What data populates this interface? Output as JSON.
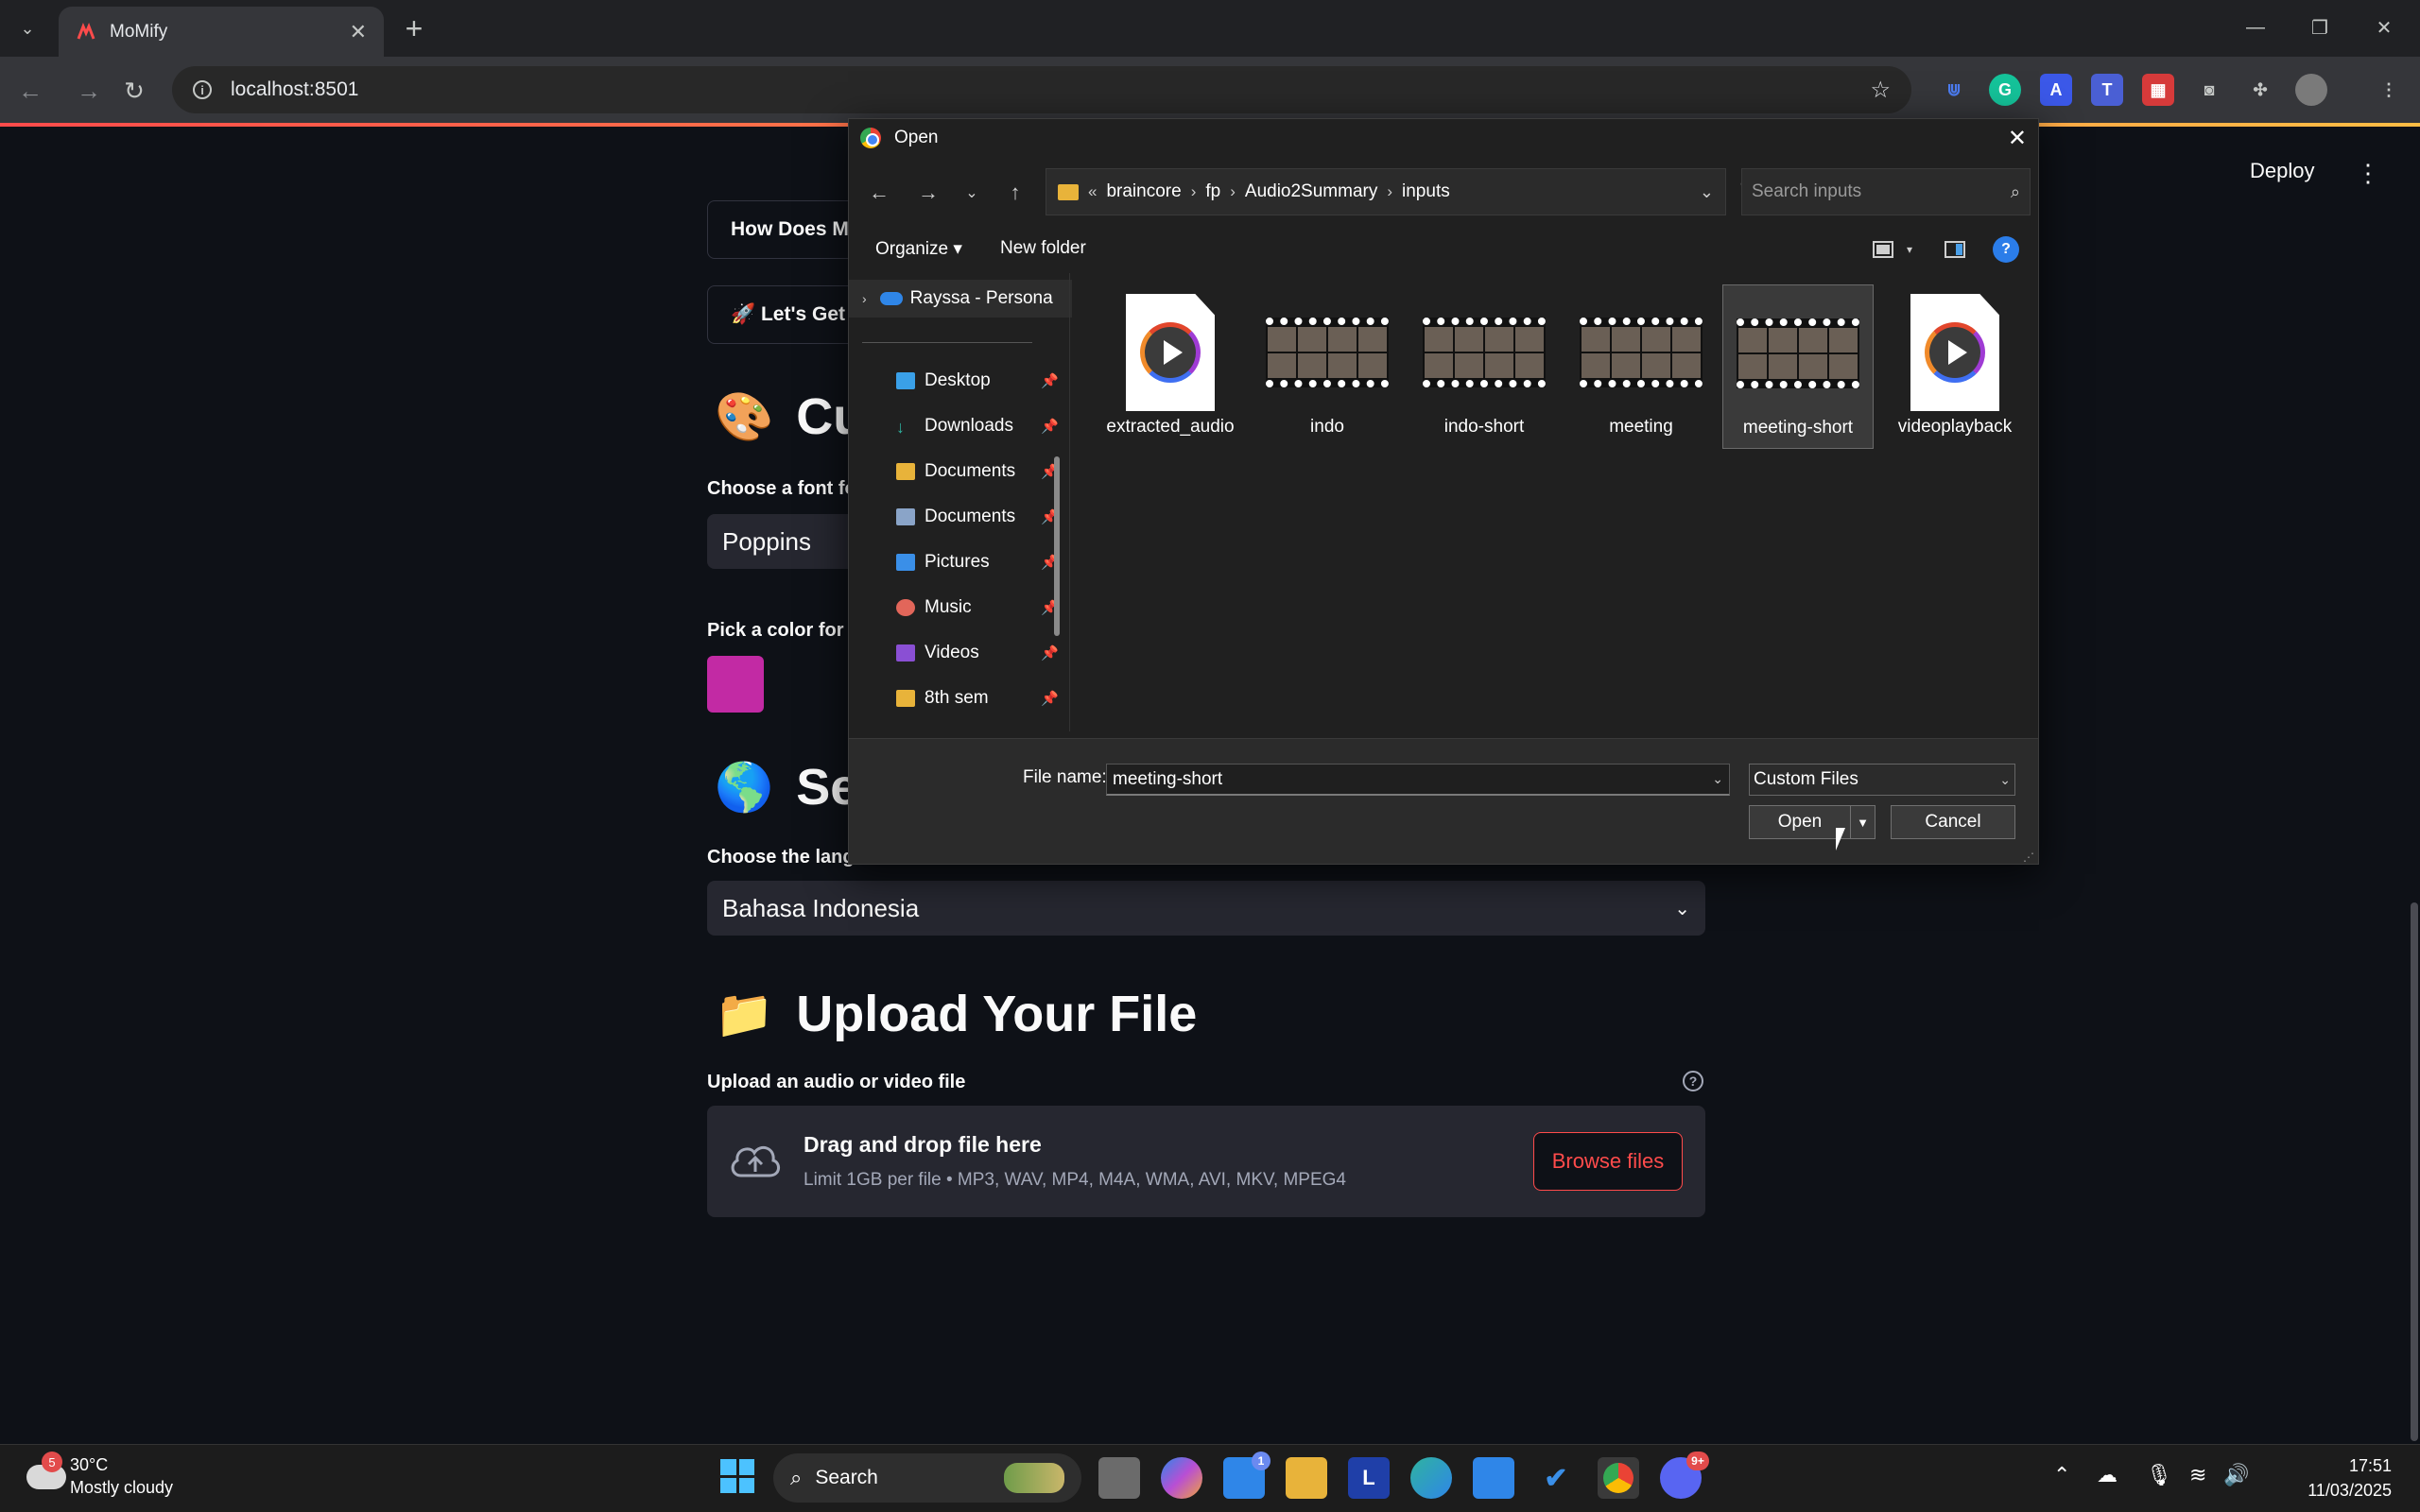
{
  "browser": {
    "tab_title": "MoMify",
    "url": "localhost:8501"
  },
  "app": {
    "deploy_label": "Deploy",
    "expander_how": "How Does MoM",
    "expander_start": "🚀 Let's Get",
    "custom_emoji": "🎨",
    "custom_title": "Cus",
    "font_label": "Choose a font fo",
    "font_value": "Poppins",
    "color_label": "Pick a color for bo",
    "color_value": "#c22aa4",
    "lang_emoji": "🌎",
    "lang_title": "Sel",
    "lang_label": "Choose the langu",
    "lang_value": "Bahasa Indonesia",
    "upload_emoji": "📁",
    "upload_title": "Upload Your File",
    "upload_label": "Upload an audio or video file",
    "drag_text": "Drag and drop file here",
    "limit_text": "Limit 1GB per file • MP3, WAV, MP4, M4A, WMA, AVI, MKV, MPEG4",
    "browse_label": "Browse files"
  },
  "dialog": {
    "title": "Open",
    "breadcrumb": [
      "braincore",
      "fp",
      "Audio2Summary",
      "inputs"
    ],
    "search_placeholder": "Search inputs",
    "organize_label": "Organize ▾",
    "new_folder_label": "New folder",
    "onedrive_label": "Rayssa - Persona",
    "nav_items": [
      {
        "label": "Desktop",
        "color": "#3aa0e8"
      },
      {
        "label": "Downloads",
        "color": "#2fb3a0"
      },
      {
        "label": "Documents",
        "color": "#e8b33a"
      },
      {
        "label": "Documents",
        "color": "#8aa4c8"
      },
      {
        "label": "Pictures",
        "color": "#3a8fe8"
      },
      {
        "label": "Music",
        "color": "#e2665a"
      },
      {
        "label": "Videos",
        "color": "#8a4fd4"
      },
      {
        "label": "8th sem",
        "color": "#e8b33a"
      }
    ],
    "files": [
      {
        "name": "extracted_audio",
        "kind": "audio"
      },
      {
        "name": "indo",
        "kind": "video"
      },
      {
        "name": "indo-short",
        "kind": "video"
      },
      {
        "name": "meeting",
        "kind": "video"
      },
      {
        "name": "meeting-short",
        "kind": "video",
        "selected": true
      },
      {
        "name": "videoplayback",
        "kind": "audio"
      }
    ],
    "file_name_label": "File name:",
    "file_name_value": "meeting-short",
    "file_type_value": "Custom Files",
    "open_label": "Open",
    "cancel_label": "Cancel"
  },
  "taskbar": {
    "weather_badge": "5",
    "temperature": "30°C",
    "condition": "Mostly cloudy",
    "search_label": "Search",
    "store_badge": "1",
    "discord_badge": "9+",
    "time": "17:51",
    "date": "11/03/2025"
  }
}
